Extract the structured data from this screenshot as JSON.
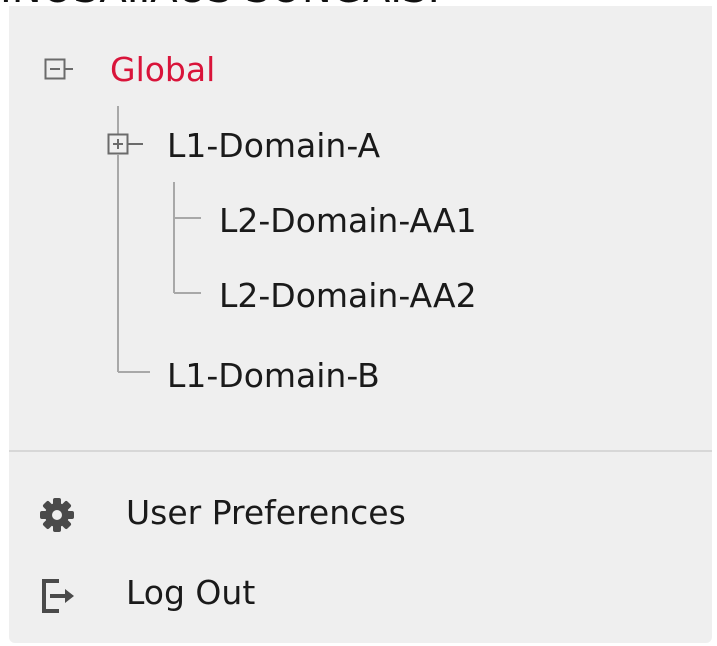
{
  "header_fragment": "INOSAIIAUS SONGAIS.",
  "tree": {
    "root": {
      "label": "Global",
      "color": "#d9143a",
      "state": "expanded"
    },
    "nodes": [
      {
        "label": "L1-Domain-A",
        "level": 1,
        "state": "expanded"
      },
      {
        "label": "L2-Domain-AA1",
        "level": 2
      },
      {
        "label": "L2-Domain-AA2",
        "level": 2
      },
      {
        "label": "L1-Domain-B",
        "level": 1
      }
    ]
  },
  "menu": {
    "items": [
      {
        "label": "User Preferences",
        "icon": "gear-icon"
      },
      {
        "label": "Log Out",
        "icon": "logout-icon"
      }
    ]
  }
}
